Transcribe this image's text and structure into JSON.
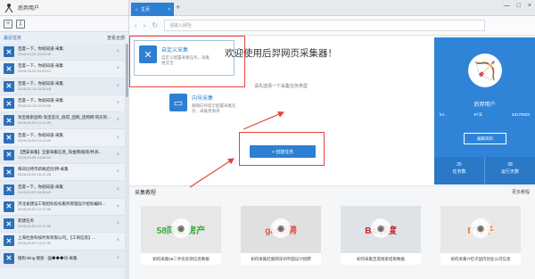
{
  "app": {
    "title": "后羿用户"
  },
  "toolbar": {
    "add_icon": "+",
    "import_icon": "⇩"
  },
  "sidebar": {
    "recent_label": "最近任务",
    "view_all_label": "查看全部",
    "tasks": [
      {
        "name": "百度一下，你就知道-采集",
        "time": "2018-03-20 10:03:32"
      },
      {
        "name": "百度一下，你就知道-采集",
        "time": "2018-03-20 10:03:12"
      },
      {
        "name": "百度一下，你就知道-采集",
        "time": "2018-03-19 15:28:18"
      },
      {
        "name": "百度一下，你就知道-采集",
        "time": "2018-03-19 12:02:08"
      },
      {
        "name": "淘宝搜索团购-淘宝首页_值得_团购_团购网 购买的...",
        "time": "2018-03-09 14:12:29"
      },
      {
        "name": "百度一下，你就知道-采集",
        "time": "2018-03-09 14:12:29"
      },
      {
        "name": "【西安采集】全部采集信息_淘金网/服装/杯具...",
        "time": "2018-03-09 14:06:51"
      },
      {
        "name": "每日比特币新闻|巴比特-采集",
        "time": "2018-03-09 16:12:25"
      },
      {
        "name": "百度一下，你就知道-采集",
        "time": "2018-03-09 16:58:15"
      },
      {
        "name": "河北省建设工程招标投标服务管理设计招标编码...",
        "time": "2018-03-09 12:17:45"
      },
      {
        "name": "新建任务",
        "time": "2018-03-09 12:17:06"
      },
      {
        "name": "上海社会科技时尚有限公司_【工商信息】...",
        "time": "2018-03-09 14:17:33"
      },
      {
        "name": "搜狗 Bing 搜索 - 国◆◆◆问-采集",
        "time": ""
      }
    ]
  },
  "browser": {
    "tab_label": "主页",
    "url_placeholder": "请输入网址"
  },
  "main": {
    "welcome": "欢迎使用后羿网页采集器！",
    "subtitle": "请先选择一个采集任务类型",
    "wizard_title": "向导采集",
    "wizard_desc": "跟随向导提示配置采集任务，采集更简单",
    "custom_title": "自定义采集",
    "custom_desc": "自定义配置采集任务，采集更灵活",
    "create_button": "+ 创建任务"
  },
  "profile": {
    "name": "后羿用户",
    "stat1": "lv1",
    "stat2": "87天",
    "stat3": "53175003",
    "edit_button": "编辑资料",
    "tasks_count": "25",
    "tasks_label": "任务数",
    "days_count": "38",
    "days_label": "运行天数"
  },
  "tutorials": {
    "title": "采集教程",
    "more": "更多教程",
    "items": [
      {
        "img_text": "58同城·房产",
        "caption": "如何采集58二手房房源信息数据"
      },
      {
        "img_text": "gar招聘",
        "caption": "如何采集赶集网深圳平面设计招聘"
      },
      {
        "img_text": "Bai百度",
        "caption": "如何采集百度搜索结果数据"
      },
      {
        "img_text": "IT桔子",
        "caption": "如何采集IT桔子国内创业公司信息"
      }
    ]
  },
  "colors": {
    "accent": "#2d7fd3",
    "highlight": "#e2453c"
  }
}
